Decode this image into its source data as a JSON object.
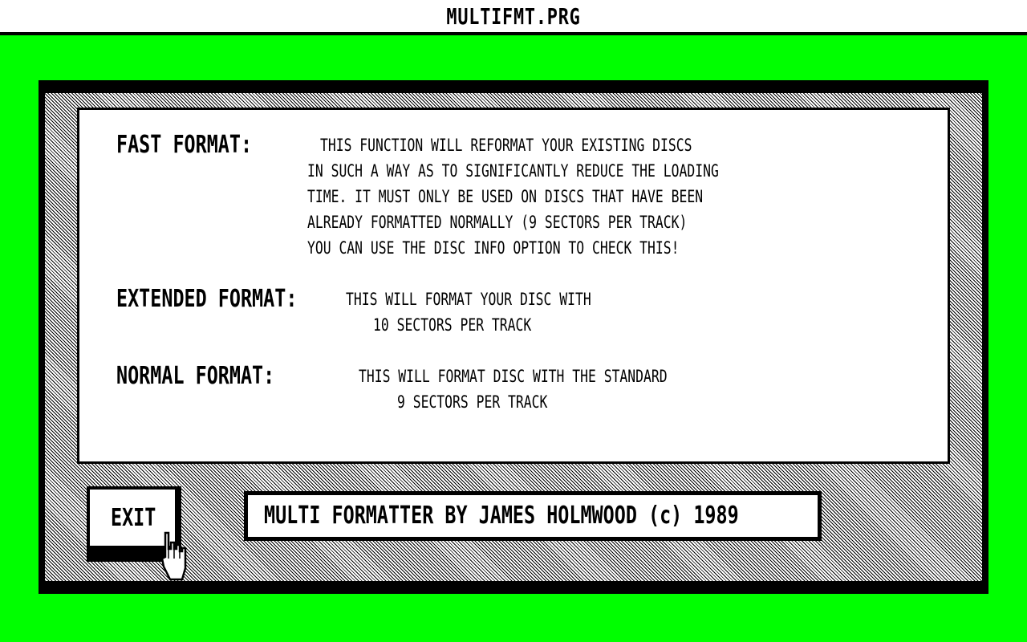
{
  "window": {
    "title": "MULTIFMT.PRG"
  },
  "info": {
    "fast": {
      "heading": "FAST FORMAT:",
      "lines": [
        "THIS FUNCTION WILL REFORMAT YOUR EXISTING DISCS",
        "IN SUCH A WAY AS TO SIGNIFICANTLY REDUCE THE LOADING",
        "TIME. IT MUST ONLY BE USED ON DISCS THAT HAVE BEEN",
        "ALREADY FORMATTED NORMALLY (9 SECTORS PER TRACK)",
        "YOU CAN USE THE DISC INFO OPTION TO CHECK THIS!"
      ]
    },
    "extended": {
      "heading": "EXTENDED FORMAT:",
      "lines": [
        "THIS WILL FORMAT YOUR DISC WITH",
        "10 SECTORS PER TRACK"
      ]
    },
    "normal": {
      "heading": "NORMAL FORMAT:",
      "lines": [
        "THIS WILL FORMAT DISC WITH THE STANDARD",
        "9 SECTORS PER TRACK"
      ]
    }
  },
  "buttons": {
    "exit_label": "EXIT"
  },
  "credit": {
    "text": "MULTI FORMATTER BY JAMES HOLMWOOD (c) 1989"
  },
  "colors": {
    "desktop": "#00ff00",
    "panel": "#ffffff",
    "ink": "#000000"
  },
  "icons": {
    "cursor": "pointing-hand-icon"
  }
}
